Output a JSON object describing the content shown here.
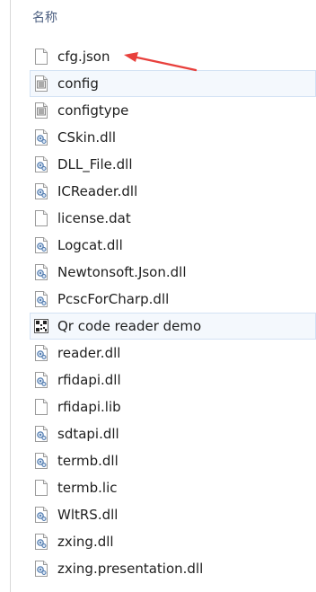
{
  "header": {
    "name_column": "名称"
  },
  "files": [
    {
      "name": "cfg.json",
      "icon": "blank-file-icon",
      "highlight": false
    },
    {
      "name": "config",
      "icon": "settings-file-icon",
      "highlight": true
    },
    {
      "name": "configtype",
      "icon": "settings-file-icon",
      "highlight": false
    },
    {
      "name": "CSkin.dll",
      "icon": "dll-file-icon",
      "highlight": false
    },
    {
      "name": "DLL_File.dll",
      "icon": "dll-file-icon",
      "highlight": false
    },
    {
      "name": "ICReader.dll",
      "icon": "dll-file-icon",
      "highlight": false
    },
    {
      "name": "license.dat",
      "icon": "blank-file-icon",
      "highlight": false
    },
    {
      "name": "Logcat.dll",
      "icon": "dll-file-icon",
      "highlight": false
    },
    {
      "name": "Newtonsoft.Json.dll",
      "icon": "dll-file-icon",
      "highlight": false
    },
    {
      "name": "PcscForCharp.dll",
      "icon": "dll-file-icon",
      "highlight": false
    },
    {
      "name": "Qr code reader demo",
      "icon": "qr-app-icon",
      "highlight": true
    },
    {
      "name": "reader.dll",
      "icon": "dll-file-icon",
      "highlight": false
    },
    {
      "name": "rfidapi.dll",
      "icon": "dll-file-icon",
      "highlight": false
    },
    {
      "name": "rfidapi.lib",
      "icon": "blank-file-icon",
      "highlight": false
    },
    {
      "name": "sdtapi.dll",
      "icon": "dll-file-icon",
      "highlight": false
    },
    {
      "name": "termb.dll",
      "icon": "dll-file-icon",
      "highlight": false
    },
    {
      "name": "termb.lic",
      "icon": "blank-file-icon",
      "highlight": false
    },
    {
      "name": "WltRS.dll",
      "icon": "dll-file-icon",
      "highlight": false
    },
    {
      "name": "zxing.dll",
      "icon": "dll-file-icon",
      "highlight": false
    },
    {
      "name": "zxing.presentation.dll",
      "icon": "dll-file-icon",
      "highlight": false
    }
  ],
  "colors": {
    "arrow": "#e8403c",
    "header_text": "#4d6082",
    "highlight_bg": "#f4f8fd",
    "highlight_border": "#d3e2f4"
  }
}
